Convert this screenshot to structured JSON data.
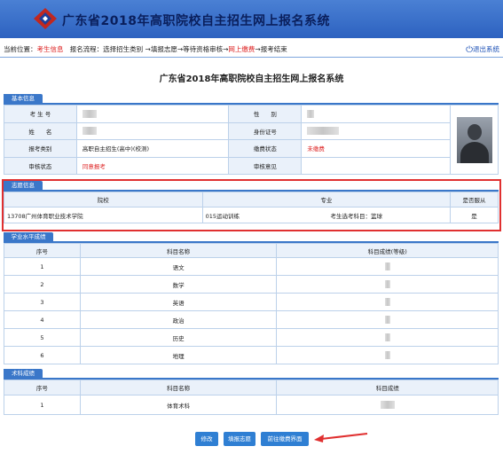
{
  "header": {
    "title": "广东省2018年高职院校自主招生网上报名系统"
  },
  "nav": {
    "location_label": "当前位置：",
    "location_value": "考生信息",
    "flow_label": "报名流程：",
    "steps": [
      "选择招生类别",
      "填报志愿",
      "等待资格审核",
      "网上缴费",
      "报考结束"
    ],
    "logout": "退出系统"
  },
  "page_title": "广东省2018年高职院校自主招生网上报名系统",
  "basic": {
    "section": "基本信息",
    "exam_no_label": "考 生 号",
    "gender_label": "性　　别",
    "name_label": "姓　　名",
    "id_label": "身份证号",
    "category_label": "报考类别",
    "category_value": "高职自主招生(高中)(校测)",
    "pay_label": "缴费状态",
    "pay_value": "未缴费",
    "audit_label": "审核状态",
    "audit_value": "同意报考",
    "opinion_label": "审核意见"
  },
  "volunteer": {
    "section": "志愿信息",
    "headers": [
      "院校",
      "专业",
      "是否服从"
    ],
    "school": "13708广州体育职业技术学院",
    "major": "015运动训练",
    "subject": "考生选考科目：篮球",
    "obey": "是"
  },
  "academic": {
    "section": "学业水平成绩",
    "headers": [
      "序号",
      "科目名称",
      "科目成绩(等级)"
    ],
    "rows": [
      {
        "no": "1",
        "name": "语文"
      },
      {
        "no": "2",
        "name": "数学"
      },
      {
        "no": "3",
        "name": "英语"
      },
      {
        "no": "4",
        "name": "政治"
      },
      {
        "no": "5",
        "name": "历史"
      },
      {
        "no": "6",
        "name": "地理"
      }
    ]
  },
  "skill": {
    "section": "术科成绩",
    "headers": [
      "序号",
      "科目名称",
      "科目成绩"
    ],
    "rows": [
      {
        "no": "1",
        "name": "体育术科"
      }
    ]
  },
  "buttons": {
    "modify": "修改",
    "fill": "填报志愿",
    "pay": "前往缴费界面"
  },
  "colors": {
    "header": "#2d62c0",
    "section": "#3a77c9",
    "button": "#2f7fd3",
    "highlight": "#e03030"
  }
}
